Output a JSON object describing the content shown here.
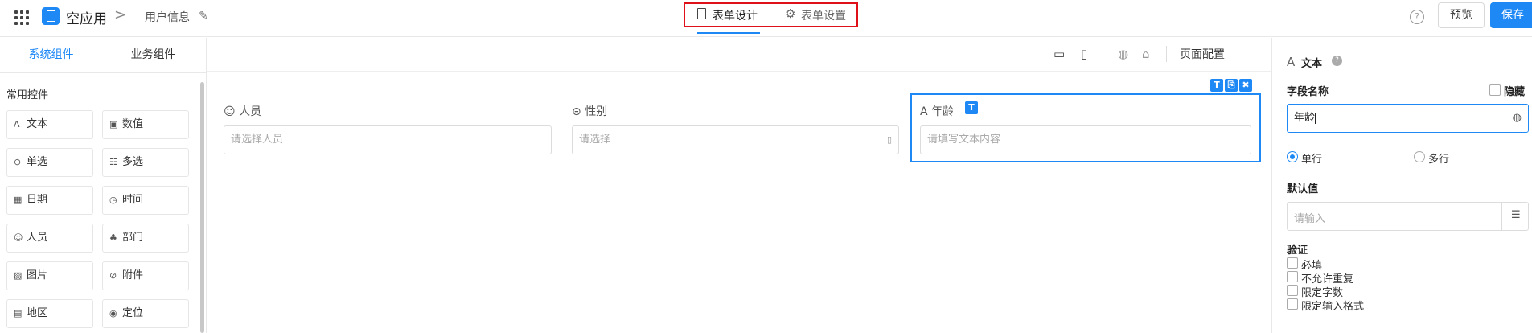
{
  "header": {
    "app_name": "空应用",
    "breadcrumb_sep": ">",
    "page_name": "用户信息",
    "tabs": [
      {
        "label": "表单设计",
        "active": true
      },
      {
        "label": "表单设置",
        "active": false
      }
    ],
    "help": "?",
    "preview_label": "预览",
    "save_label": "保存"
  },
  "left_panel": {
    "tabs": [
      {
        "label": "系统组件",
        "active": true
      },
      {
        "label": "业务组件",
        "active": false
      }
    ],
    "section_title": "常用控件",
    "components": [
      {
        "icon": "A",
        "label": "文本"
      },
      {
        "icon": "▣",
        "label": "数值"
      },
      {
        "icon": "⊝",
        "label": "单选"
      },
      {
        "icon": "☷",
        "label": "多选"
      },
      {
        "icon": "▦",
        "label": "日期"
      },
      {
        "icon": "◷",
        "label": "时间"
      },
      {
        "icon": "☺",
        "label": "人员"
      },
      {
        "icon": "♣",
        "label": "部门"
      },
      {
        "icon": "▨",
        "label": "图片"
      },
      {
        "icon": "⊘",
        "label": "附件"
      },
      {
        "icon": "▤",
        "label": "地区"
      },
      {
        "icon": "◉",
        "label": "定位"
      }
    ]
  },
  "canvas": {
    "toolbar": {
      "page_config": "页面配置"
    },
    "fields": [
      {
        "icon": "☺",
        "label": "人员",
        "placeholder": "请选择人员"
      },
      {
        "icon": "⊝",
        "label": "性别",
        "placeholder": "请选择"
      },
      {
        "icon": "A",
        "label": "年龄",
        "placeholder": "请填写文本内容",
        "badge": "T"
      }
    ]
  },
  "right_panel": {
    "title_icon": "A",
    "title": "文本",
    "field_name_label": "字段名称",
    "hidden_label": "隐藏",
    "field_name_value": "年龄",
    "line_options": [
      {
        "label": "单行",
        "selected": true
      },
      {
        "label": "多行",
        "selected": false
      }
    ],
    "default_label": "默认值",
    "default_placeholder": "请输入",
    "validation_label": "验证",
    "validations": [
      "必填",
      "不允许重复",
      "限定字数",
      "限定输入格式"
    ]
  },
  "colors": {
    "accent": "#1e88f5",
    "highlight_border": "#e0101a"
  }
}
